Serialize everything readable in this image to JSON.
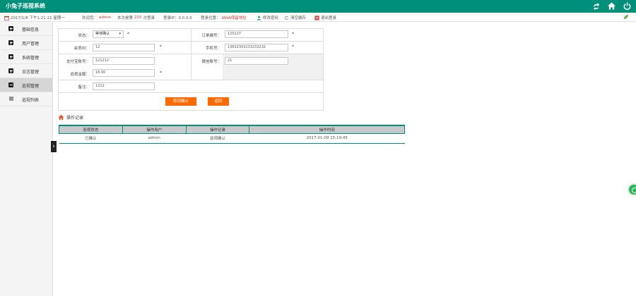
{
  "app": {
    "title": "小兔子巡视系统"
  },
  "topbar": {
    "icons": [
      "share-icon",
      "home-icon",
      "power-icon"
    ]
  },
  "infobar": {
    "datetime": "2017/1/8 下午1:21:21 星期一",
    "welcome_prefix": "欢迎您：",
    "welcome_user": "admin",
    "login_count_prefix": "本次是第",
    "login_count": "210",
    "login_count_suffix": "次登录",
    "ip": "登录IP：0.0.0.0",
    "location_prefix": "登录位置：",
    "location": "IANA保留地址",
    "change_password": "修改密码",
    "clear_cache": "清空缓存",
    "logout": "退出登录"
  },
  "sidebar": {
    "items": [
      {
        "label": "基础信息",
        "icon": "plus-box-icon"
      },
      {
        "label": "用户管理",
        "icon": "plus-box-icon"
      },
      {
        "label": "系统管理",
        "icon": "plus-box-icon"
      },
      {
        "label": "日志管理",
        "icon": "plus-box-icon"
      },
      {
        "label": "巡视管理",
        "icon": "minus-box-icon"
      },
      {
        "label": "巡视列表",
        "icon": "list-icon"
      }
    ],
    "toggle": "›"
  },
  "form": {
    "status_label": "状态：",
    "status_value": "等待确认",
    "order_no_label": "订单编号：",
    "order_no_value": "120127",
    "member_id_label": "会员ID：",
    "member_id_value": "12",
    "phone_label": "手机号：",
    "phone_value": "13632303233233232",
    "account_label": "支付宝账号：",
    "account_value": "121212",
    "wechat_label": "微信账号：",
    "wechat_value": "21",
    "amount_label": "巡视金额：",
    "amount_value": "18.00",
    "remark_label": "备注：",
    "remark_value": "1212",
    "required_mark": "*",
    "cancel_button": "取消确认",
    "back_button": "返回"
  },
  "log": {
    "title": "操作记录",
    "columns": [
      "巡视状态",
      "操作用户",
      "操作记录",
      "操作时间"
    ],
    "rows": [
      [
        "已确认",
        "admin",
        "巡视确认",
        "2017-01-09 15:19:45"
      ]
    ]
  },
  "colors": {
    "brand": "#008f7a",
    "button": "#ff6a00",
    "accent_red": "#e03030"
  }
}
